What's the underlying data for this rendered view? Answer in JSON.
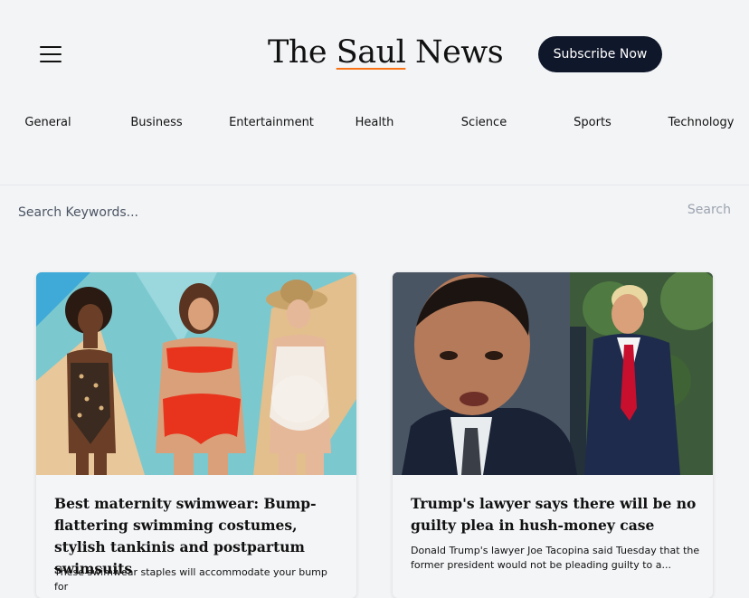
{
  "header": {
    "brand_part1": "The ",
    "brand_accent": "Saul",
    "brand_part2": " News",
    "subscribe_label": "Subscribe Now",
    "accent_color": "#f97316",
    "button_color": "#0f172a"
  },
  "categories": [
    {
      "label": "General"
    },
    {
      "label": "Business"
    },
    {
      "label": "Entertainment"
    },
    {
      "label": "Health"
    },
    {
      "label": "Science"
    },
    {
      "label": "Sports"
    },
    {
      "label": "Technology"
    }
  ],
  "search": {
    "placeholder": "Search Keywords...",
    "button_label": "Search"
  },
  "articles": [
    {
      "title": "Best maternity swimwear: Bump-flattering swimming costumes, stylish tankinis and postpartum swimsuits",
      "description": "These swimwear staples will accommodate your bump for"
    },
    {
      "title": "Trump's lawyer says there will be no guilty plea in hush-money case",
      "description": "Donald Trump's lawyer Joe Tacopina said Tuesday that the former president would not be pleading guilty to a..."
    }
  ]
}
